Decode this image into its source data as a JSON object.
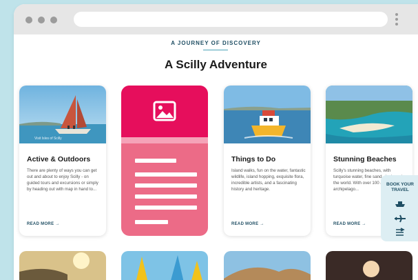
{
  "page": {
    "eyebrow": "A JOURNEY OF DISCOVERY",
    "title": "A Scilly Adventure"
  },
  "cards": [
    {
      "title": "Active & Outdoors",
      "body": "There are plenty of ways you can get out and about to enjoy Scilly - on guided tours and excursions or simply by heading out with map in hand to...",
      "cta": "READ MORE →",
      "caption": "Visit Isles of Scilly"
    },
    {
      "title": "Things to Do",
      "body": "Island walks, fun on the water, fantastic wildlife, island hopping, exquisite flora, incredible artists, and a fascinating history and heritage.",
      "cta": "READ MORE →"
    },
    {
      "title": "Stunning Beaches",
      "body": "Scilly's stunning beaches, with turquoise water, fine sand, rival any in the world. With over 100 across the archipelago...",
      "cta": "READ MORE →"
    }
  ],
  "book_widget": {
    "label_line1": "BOOK YOUR",
    "label_line2": "TRAVEL",
    "icons": [
      "ferry-icon",
      "plane-icon",
      "route-icon"
    ]
  },
  "colors": {
    "placeholder_top": "#e60e5c",
    "placeholder_body": "#ec6b87",
    "brand_dark": "#1f4e63",
    "background": "#bfe3ea"
  }
}
